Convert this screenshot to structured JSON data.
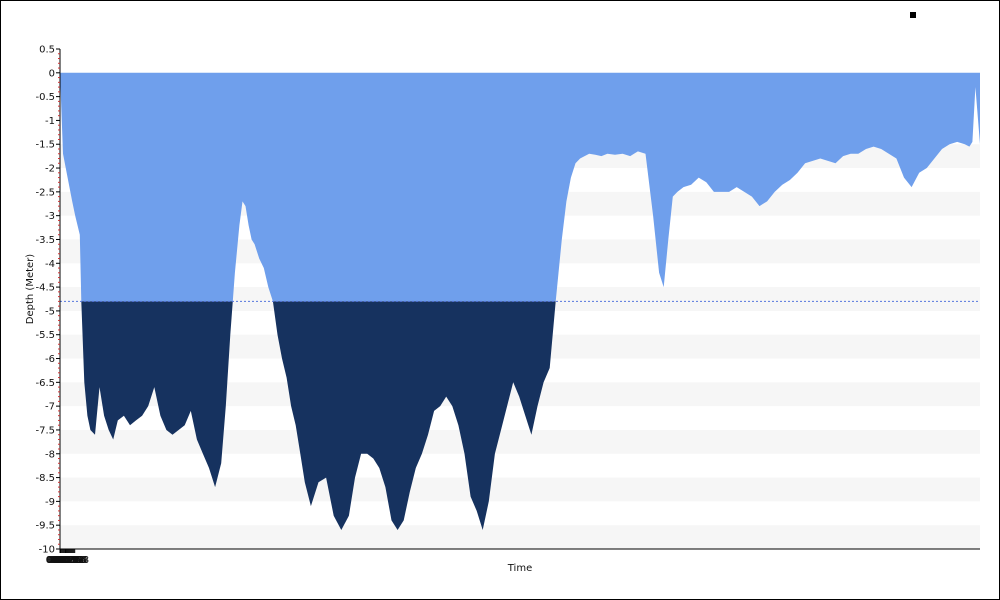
{
  "chart_data": {
    "type": "area",
    "title": "",
    "xlabel": "Time",
    "ylabel": "Depth (Meter)",
    "xlim_minutes": [
      0,
      60.5
    ],
    "ylim": [
      -10,
      0.5
    ],
    "x_tick_labels": [
      "00:00",
      "00:03",
      "00:07",
      "00:11",
      "00:15",
      "00:19",
      "00:22",
      "00:26",
      "00:30",
      "00:34",
      "00:38",
      "00:42",
      "00:46",
      "00:50",
      "00:54",
      "00:58"
    ],
    "y_tick_labels": [
      "0.5",
      "0",
      "-0.5",
      "-1",
      "-1.5",
      "-2",
      "-2.5",
      "-3",
      "-3.5",
      "-4",
      "-4.5",
      "-5",
      "-5.5",
      "-6",
      "-6.5",
      "-7",
      "-7.5",
      "-8",
      "-8.5",
      "-9",
      "-9.5",
      "-10"
    ],
    "threshold_depth": -4.8,
    "grid": "horizontal alternating bands",
    "colors": {
      "area_above_threshold": "#6f9fec",
      "area_below_threshold": "#16325f",
      "threshold_line": "#5577dd",
      "band": "#f6f6f6"
    },
    "series": [
      {
        "x_minutes": [
          0.0,
          0.2,
          0.5,
          0.8,
          1.0,
          1.3,
          1.4,
          1.6,
          1.8,
          2.0,
          2.3,
          2.6,
          2.9,
          3.2,
          3.5,
          3.8,
          4.2,
          4.6,
          5.0,
          5.4,
          5.8,
          6.2,
          6.6,
          7.0,
          7.4,
          7.8,
          8.2,
          8.6,
          9.0,
          9.4,
          9.8,
          10.2,
          10.6,
          10.9,
          11.2,
          11.5,
          11.8,
          12.0,
          12.2,
          12.4,
          12.6,
          12.8,
          13.1,
          13.4,
          13.7,
          14.0,
          14.3,
          14.6,
          14.9,
          15.2,
          15.5,
          15.8,
          16.1,
          16.5,
          17.0,
          17.5,
          18.0,
          18.5,
          19.0,
          19.4,
          19.8,
          20.2,
          20.6,
          21.0,
          21.4,
          21.8,
          22.2,
          22.6,
          23.0,
          23.4,
          23.8,
          24.2,
          24.6,
          25.0,
          25.4,
          25.8,
          26.2,
          26.6,
          27.0,
          27.4,
          27.8,
          28.2,
          28.6,
          29.0,
          29.4,
          29.8,
          30.2,
          30.6,
          31.0,
          31.4,
          31.8,
          32.2,
          32.6,
          33.0,
          33.3,
          33.6,
          33.9,
          34.2,
          34.5,
          34.8,
          35.2,
          35.6,
          36.0,
          36.5,
          37.0,
          37.5,
          38.0,
          38.5,
          39.0,
          39.4,
          39.7,
          40.0,
          40.3,
          40.6,
          41.0,
          41.5,
          42.0,
          42.5,
          43.0,
          43.5,
          44.0,
          44.5,
          45.0,
          45.5,
          46.0,
          46.5,
          47.0,
          47.5,
          48.0,
          48.5,
          49.0,
          49.5,
          50.0,
          50.5,
          51.0,
          51.5,
          52.0,
          52.5,
          53.0,
          53.5,
          54.0,
          54.5,
          55.0,
          55.5,
          56.0,
          56.5,
          57.0,
          57.5,
          58.0,
          58.5,
          59.0,
          59.5,
          59.8,
          60.0,
          60.2,
          60.5
        ],
        "depth": [
          0.0,
          -1.7,
          -2.2,
          -2.7,
          -3.0,
          -3.4,
          -4.8,
          -6.5,
          -7.2,
          -7.5,
          -7.6,
          -6.6,
          -7.2,
          -7.5,
          -7.7,
          -7.3,
          -7.2,
          -7.4,
          -7.3,
          -7.2,
          -7.0,
          -6.6,
          -7.2,
          -7.5,
          -7.6,
          -7.5,
          -7.4,
          -7.1,
          -7.7,
          -8.0,
          -8.3,
          -8.7,
          -8.2,
          -7.0,
          -5.5,
          -4.2,
          -3.2,
          -2.7,
          -2.8,
          -3.2,
          -3.5,
          -3.6,
          -3.9,
          -4.1,
          -4.5,
          -4.8,
          -5.5,
          -6.0,
          -6.4,
          -7.0,
          -7.4,
          -8.0,
          -8.6,
          -9.1,
          -8.6,
          -8.5,
          -9.3,
          -9.6,
          -9.3,
          -8.5,
          -8.0,
          -8.0,
          -8.1,
          -8.3,
          -8.7,
          -9.4,
          -9.6,
          -9.4,
          -8.8,
          -8.3,
          -8.0,
          -7.6,
          -7.1,
          -7.0,
          -6.8,
          -7.0,
          -7.4,
          -8.0,
          -8.9,
          -9.2,
          -9.6,
          -9.0,
          -8.0,
          -7.5,
          -7.0,
          -6.5,
          -6.8,
          -7.2,
          -7.6,
          -7.0,
          -6.5,
          -6.2,
          -4.8,
          -3.5,
          -2.7,
          -2.2,
          -1.9,
          -1.8,
          -1.75,
          -1.7,
          -1.72,
          -1.75,
          -1.7,
          -1.72,
          -1.7,
          -1.75,
          -1.65,
          -1.7,
          -3.0,
          -4.2,
          -4.5,
          -3.5,
          -2.6,
          -2.5,
          -2.4,
          -2.35,
          -2.2,
          -2.3,
          -2.5,
          -2.5,
          -2.5,
          -2.4,
          -2.5,
          -2.6,
          -2.8,
          -2.7,
          -2.5,
          -2.35,
          -2.25,
          -2.1,
          -1.9,
          -1.85,
          -1.8,
          -1.85,
          -1.9,
          -1.75,
          -1.7,
          -1.7,
          -1.6,
          -1.55,
          -1.6,
          -1.7,
          -1.8,
          -2.2,
          -2.4,
          -2.1,
          -2.0,
          -1.8,
          -1.6,
          -1.5,
          -1.45,
          -1.5,
          -1.55,
          -1.45,
          -0.3,
          -1.5,
          -1.5,
          -1.4
        ]
      }
    ]
  }
}
